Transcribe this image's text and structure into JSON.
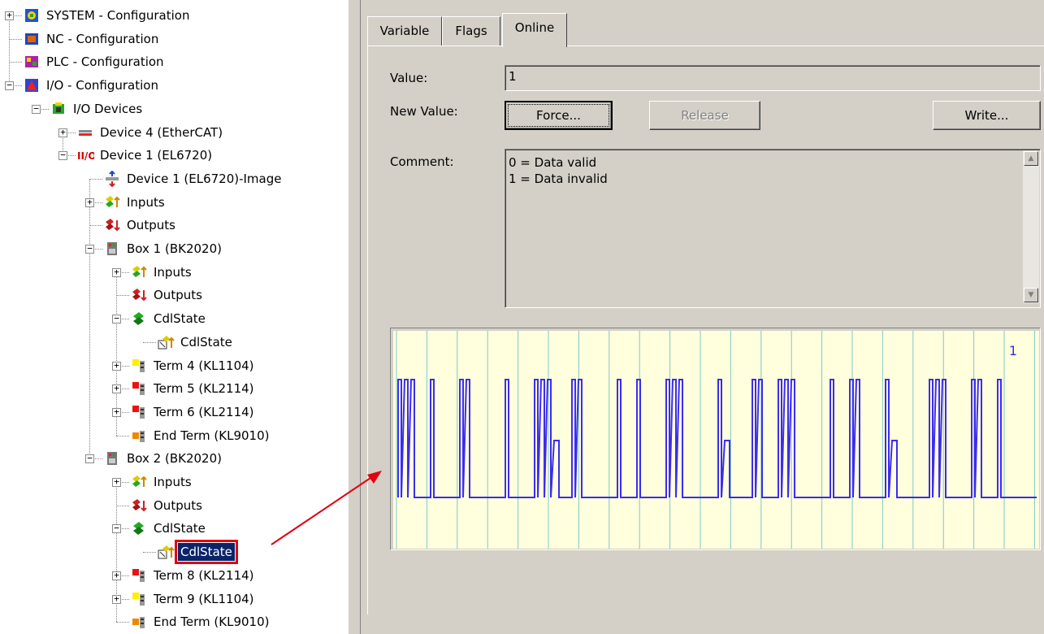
{
  "tree": {
    "items": [
      {
        "label": "SYSTEM - Configuration",
        "icon": "system-config-icon",
        "expander": "+",
        "depth": 0
      },
      {
        "label": "NC - Configuration",
        "icon": "nc-config-icon",
        "expander": "",
        "depth": 0
      },
      {
        "label": "PLC - Configuration",
        "icon": "plc-config-icon",
        "expander": "",
        "depth": 0
      },
      {
        "label": "I/O - Configuration",
        "icon": "io-config-icon",
        "expander": "−",
        "depth": 0
      },
      {
        "label": "I/O Devices",
        "icon": "io-devices-icon",
        "expander": "−",
        "depth": 1
      },
      {
        "label": "Device 4 (EtherCAT)",
        "icon": "ethercat-device-icon",
        "expander": "+",
        "depth": 2
      },
      {
        "label": "Device 1 (EL6720)",
        "icon": "io-device-icon",
        "expander": "−",
        "depth": 2
      },
      {
        "label": "Device 1 (EL6720)-Image",
        "icon": "image-icon",
        "expander": "",
        "depth": 3
      },
      {
        "label": "Inputs",
        "icon": "inputs-icon",
        "expander": "+",
        "depth": 3
      },
      {
        "label": "Outputs",
        "icon": "outputs-icon",
        "expander": "",
        "depth": 3
      },
      {
        "label": "Box 1 (BK2020)",
        "icon": "box-icon",
        "expander": "−",
        "depth": 3
      },
      {
        "label": "Inputs",
        "icon": "inputs-icon",
        "expander": "+",
        "depth": 4
      },
      {
        "label": "Outputs",
        "icon": "outputs-icon",
        "expander": "",
        "depth": 4
      },
      {
        "label": "CdlState",
        "icon": "state-icon",
        "expander": "−",
        "depth": 4
      },
      {
        "label": "CdlState",
        "icon": "variable-input-icon",
        "expander": "",
        "depth": 5
      },
      {
        "label": "Term 4 (KL1104)",
        "icon": "terminal-yellow-icon",
        "expander": "+",
        "depth": 4
      },
      {
        "label": "Term 5 (KL2114)",
        "icon": "terminal-red-icon",
        "expander": "+",
        "depth": 4
      },
      {
        "label": "Term 6 (KL2114)",
        "icon": "terminal-red-icon",
        "expander": "+",
        "depth": 4
      },
      {
        "label": "End Term (KL9010)",
        "icon": "terminal-end-icon",
        "expander": "",
        "depth": 4
      },
      {
        "label": "Box 2 (BK2020)",
        "icon": "box-icon",
        "expander": "−",
        "depth": 3
      },
      {
        "label": "Inputs",
        "icon": "inputs-icon",
        "expander": "+",
        "depth": 4
      },
      {
        "label": "Outputs",
        "icon": "outputs-icon",
        "expander": "",
        "depth": 4
      },
      {
        "label": "CdlState",
        "icon": "state-icon",
        "expander": "−",
        "depth": 4
      },
      {
        "label": "CdlState",
        "icon": "variable-input-icon",
        "expander": "",
        "depth": 5,
        "selected": true
      },
      {
        "label": "Term 8 (KL2114)",
        "icon": "terminal-red-icon",
        "expander": "+",
        "depth": 4
      },
      {
        "label": "Term 9 (KL1104)",
        "icon": "terminal-yellow-icon",
        "expander": "+",
        "depth": 4
      },
      {
        "label": "End Term (KL9010)",
        "icon": "terminal-end-icon",
        "expander": "",
        "depth": 4
      }
    ]
  },
  "tabs": {
    "variable": "Variable",
    "flags": "Flags",
    "online": "Online"
  },
  "online": {
    "value_label": "Value:",
    "value": "1",
    "new_value_label": "New Value:",
    "force_label": "Force...",
    "release_label": "Release",
    "write_label": "Write...",
    "comment_label": "Comment:",
    "comment_line1": "0 = Data valid",
    "comment_line2": "1 = Data invalid",
    "chart_value": "1"
  },
  "colors": {
    "selection": "#0a246a",
    "highlight_border": "#e3000f",
    "arrow": "#e3000f",
    "signal": "#3c2cf0",
    "chart_bg": "#ffffde",
    "chart_grid": "#7fc8c8"
  }
}
